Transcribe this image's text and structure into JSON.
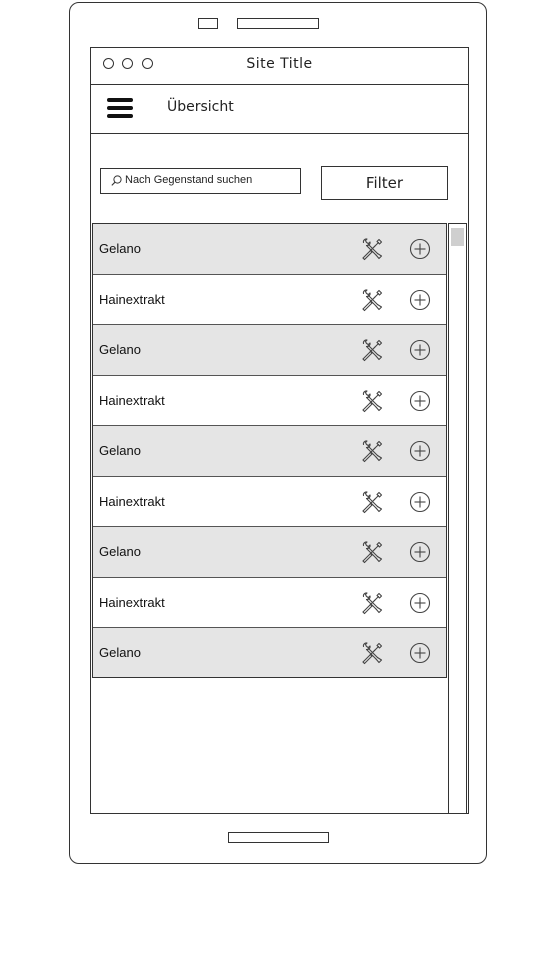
{
  "window": {
    "title": "Site Title"
  },
  "nav": {
    "menu_icon": "hamburger-icon",
    "title": "Übersicht"
  },
  "search": {
    "placeholder": "Nach Gegenstand suchen",
    "icon": "search-icon"
  },
  "filter": {
    "label": "Filter"
  },
  "items": [
    {
      "label": "Gelano"
    },
    {
      "label": "Hainextrakt"
    },
    {
      "label": "Gelano"
    },
    {
      "label": "Hainextrakt"
    },
    {
      "label": "Gelano"
    },
    {
      "label": "Hainextrakt"
    },
    {
      "label": "Gelano"
    },
    {
      "label": "Hainextrakt"
    },
    {
      "label": "Gelano"
    }
  ],
  "row_icons": {
    "edit": "tools-icon",
    "add": "plus-circle-icon"
  },
  "colors": {
    "alt_row": "#e5e5e5",
    "stroke": "#333333"
  }
}
